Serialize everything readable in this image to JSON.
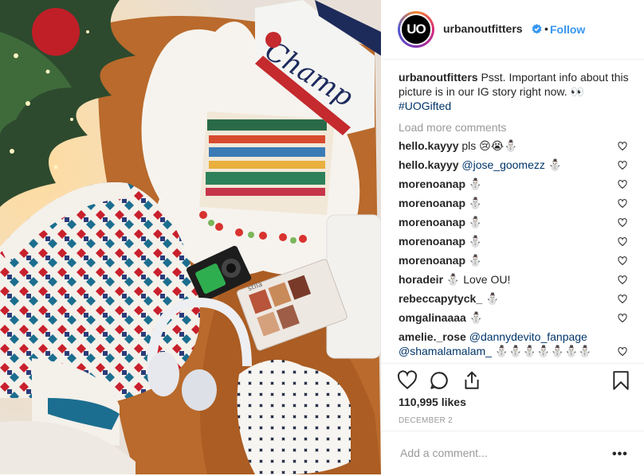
{
  "post": {
    "username": "urbanoutfitters",
    "avatar_text": "UO",
    "dot": "•",
    "follow_label": "Follow",
    "caption_user": "urbanoutfitters",
    "caption_text": " Psst. Important info about this picture is in our IG story right now. 👀",
    "caption_tag": "#UOGifted",
    "load_more": "Load more comments",
    "comments": [
      {
        "user": "hello.kayyy",
        "text": " pls 😢😭⛄"
      },
      {
        "user": "hello.kayyy",
        "mention": " @jose_goomezz",
        "text": " ⛄"
      },
      {
        "user": "morenoanap",
        "text": " ⛄"
      },
      {
        "user": "morenoanap",
        "text": " ⛄"
      },
      {
        "user": "morenoanap",
        "text": " ⛄"
      },
      {
        "user": "morenoanap",
        "text": " ⛄"
      },
      {
        "user": "morenoanap",
        "text": " ⛄"
      },
      {
        "user": "horadeir",
        "text": " ⛄ Love OU!"
      },
      {
        "user": "rebeccapytyck_",
        "text": " ⛄"
      },
      {
        "user": "omgalinaaaa",
        "text": " ⛄"
      },
      {
        "user": "amelie._rose",
        "mention": " @dannydevito_fanpage",
        "mention2": "@shamalamalam_",
        "text": " ⛄⛄⛄⛄⛄⛄⛄"
      }
    ],
    "likes": "110,995 likes",
    "date": "DECEMBER 2",
    "add_comment_placeholder": "Add a comment...",
    "more_label": "•••",
    "photo_brand_text": "Champ",
    "photo_palette_text": "stila"
  },
  "colors": {
    "link": "#3897f0",
    "mention": "#003569",
    "verified": "#3897f0"
  }
}
